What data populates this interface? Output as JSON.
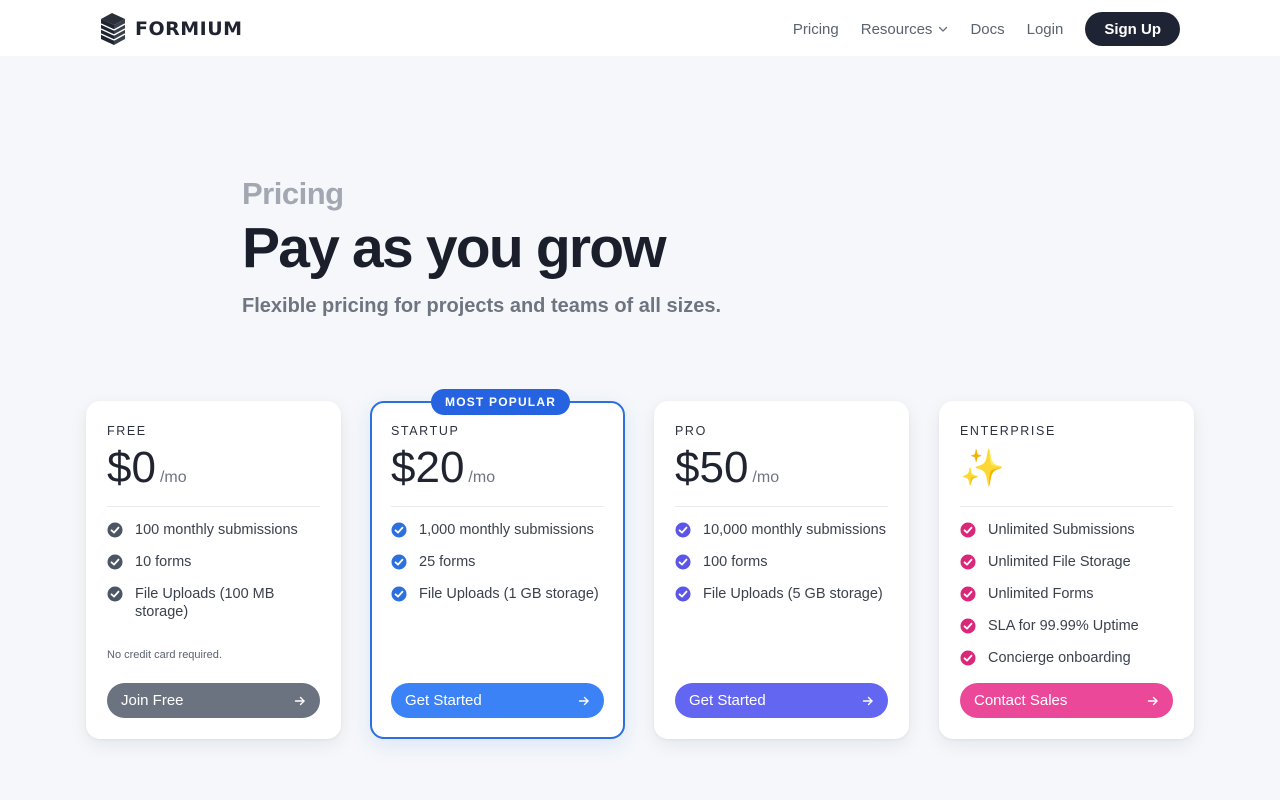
{
  "header": {
    "brand": "FORMIUM",
    "nav": [
      {
        "label": "Pricing"
      },
      {
        "label": "Resources",
        "has_dropdown": true
      },
      {
        "label": "Docs"
      },
      {
        "label": "Login"
      }
    ],
    "signup_label": "Sign Up"
  },
  "hero": {
    "eyebrow": "Pricing",
    "title": "Pay as you grow",
    "subtitle": "Flexible pricing for projects and teams of all sizes."
  },
  "plans": [
    {
      "tier": "FREE",
      "price": "$0",
      "period": "/mo",
      "features": [
        "100 monthly submissions",
        "10 forms",
        "File Uploads (100 MB storage)"
      ],
      "note": "No credit card required.",
      "cta": "Join Free",
      "check_color": "#4b5563",
      "cta_color": "#6b7280"
    },
    {
      "tier": "STARTUP",
      "badge": "MOST POPULAR",
      "price": "$20",
      "period": "/mo",
      "features": [
        "1,000 monthly submissions",
        "25 forms",
        "File Uploads (1 GB storage)"
      ],
      "cta": "Get Started",
      "check_color": "#2b6fe0",
      "cta_color": "#3b82f6"
    },
    {
      "tier": "PRO",
      "price": "$50",
      "period": "/mo",
      "features": [
        "10,000 monthly submissions",
        "100 forms",
        "File Uploads (5 GB storage)"
      ],
      "cta": "Get Started",
      "check_color": "#5b55e8",
      "cta_color": "#6366f1"
    },
    {
      "tier": "ENTERPRISE",
      "price_icon": "sparkles-icon",
      "features": [
        "Unlimited Submissions",
        "Unlimited File Storage",
        "Unlimited Forms",
        "SLA for 99.99% Uptime",
        "Concierge onboarding"
      ],
      "cta": "Contact Sales",
      "check_color": "#db2777",
      "cta_color": "#ec4899"
    }
  ],
  "colors": {
    "background": "#f5f7fa",
    "featured_border": "#2b6fe0",
    "signup_bg": "#1e2433"
  }
}
